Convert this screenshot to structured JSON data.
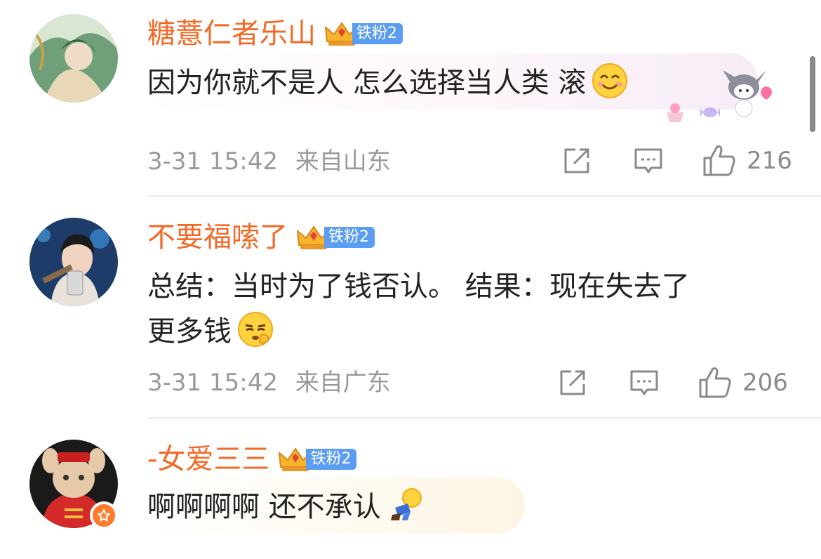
{
  "comments": [
    {
      "username": "糖薏仁者乐山",
      "fan_badge": "铁粉2",
      "text": "因为你就不是人 怎么选择当人类 滚",
      "time": "3-31 15:42",
      "location": "来自山东",
      "likes": "216"
    },
    {
      "username": "不要福嗦了",
      "fan_badge": "铁粉2",
      "text_line1": "总结：当时为了钱否认。 结果：现在失去了",
      "text_line2": "更多钱",
      "time": "3-31 15:42",
      "location": "来自广东",
      "likes": "206"
    },
    {
      "username": "-女爱三三",
      "fan_badge": "铁粉2",
      "text": "啊啊啊啊 还不承认"
    }
  ],
  "colors": {
    "username": "#f26a26",
    "fan_badge": "#5a9df2",
    "meta": "#9a9a9a"
  },
  "icons": [
    "share-icon",
    "reply-icon",
    "like-icon",
    "smile-emoji",
    "shush-emoji",
    "kneel-emoji",
    "crown-icon"
  ]
}
